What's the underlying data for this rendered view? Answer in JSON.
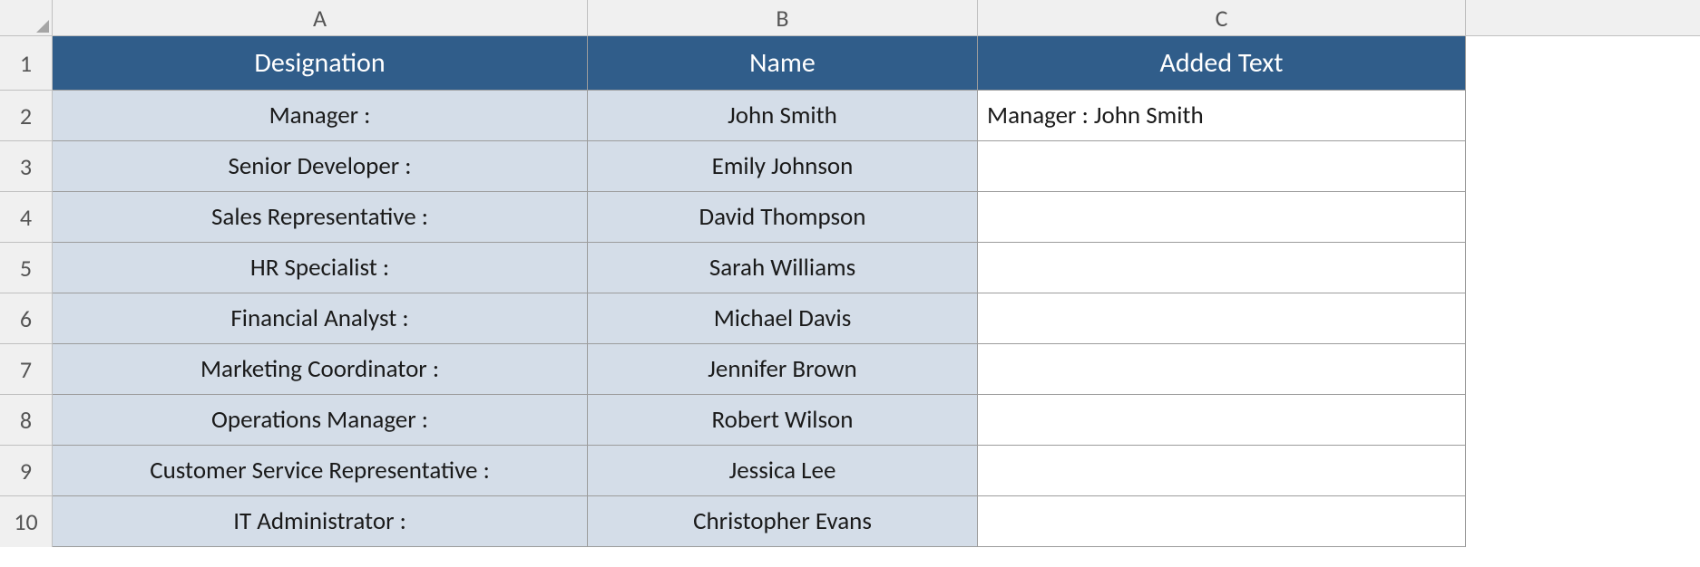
{
  "columns": {
    "a": "A",
    "b": "B",
    "c": "C"
  },
  "rowNumbers": [
    "1",
    "2",
    "3",
    "4",
    "5",
    "6",
    "7",
    "8",
    "9",
    "10"
  ],
  "headers": {
    "designation": "Designation",
    "name": "Name",
    "addedText": "Added Text"
  },
  "rows": [
    {
      "designation": "Manager :",
      "name": "John Smith",
      "added": "Manager : John Smith"
    },
    {
      "designation": "Senior Developer :",
      "name": "Emily Johnson",
      "added": ""
    },
    {
      "designation": "Sales Representative :",
      "name": "David Thompson",
      "added": ""
    },
    {
      "designation": "HR Specialist :",
      "name": "Sarah Williams",
      "added": ""
    },
    {
      "designation": "Financial Analyst :",
      "name": "Michael Davis",
      "added": ""
    },
    {
      "designation": "Marketing Coordinator :",
      "name": "Jennifer Brown",
      "added": ""
    },
    {
      "designation": "Operations Manager :",
      "name": "Robert Wilson",
      "added": ""
    },
    {
      "designation": "Customer Service Representative :",
      "name": "Jessica Lee",
      "added": ""
    },
    {
      "designation": "IT Administrator :",
      "name": "Christopher Evans",
      "added": ""
    }
  ],
  "chart_data": {
    "type": "table",
    "title": "",
    "columns": [
      "Designation",
      "Name",
      "Added Text"
    ],
    "data": [
      [
        "Manager :",
        "John Smith",
        "Manager : John Smith"
      ],
      [
        "Senior Developer :",
        "Emily Johnson",
        ""
      ],
      [
        "Sales Representative :",
        "David Thompson",
        ""
      ],
      [
        "HR Specialist :",
        "Sarah Williams",
        ""
      ],
      [
        "Financial Analyst :",
        "Michael Davis",
        ""
      ],
      [
        "Marketing Coordinator :",
        "Jennifer Brown",
        ""
      ],
      [
        "Operations Manager :",
        "Robert Wilson",
        ""
      ],
      [
        "Customer Service Representative :",
        "Jessica Lee",
        ""
      ],
      [
        "IT Administrator :",
        "Christopher Evans",
        ""
      ]
    ]
  }
}
